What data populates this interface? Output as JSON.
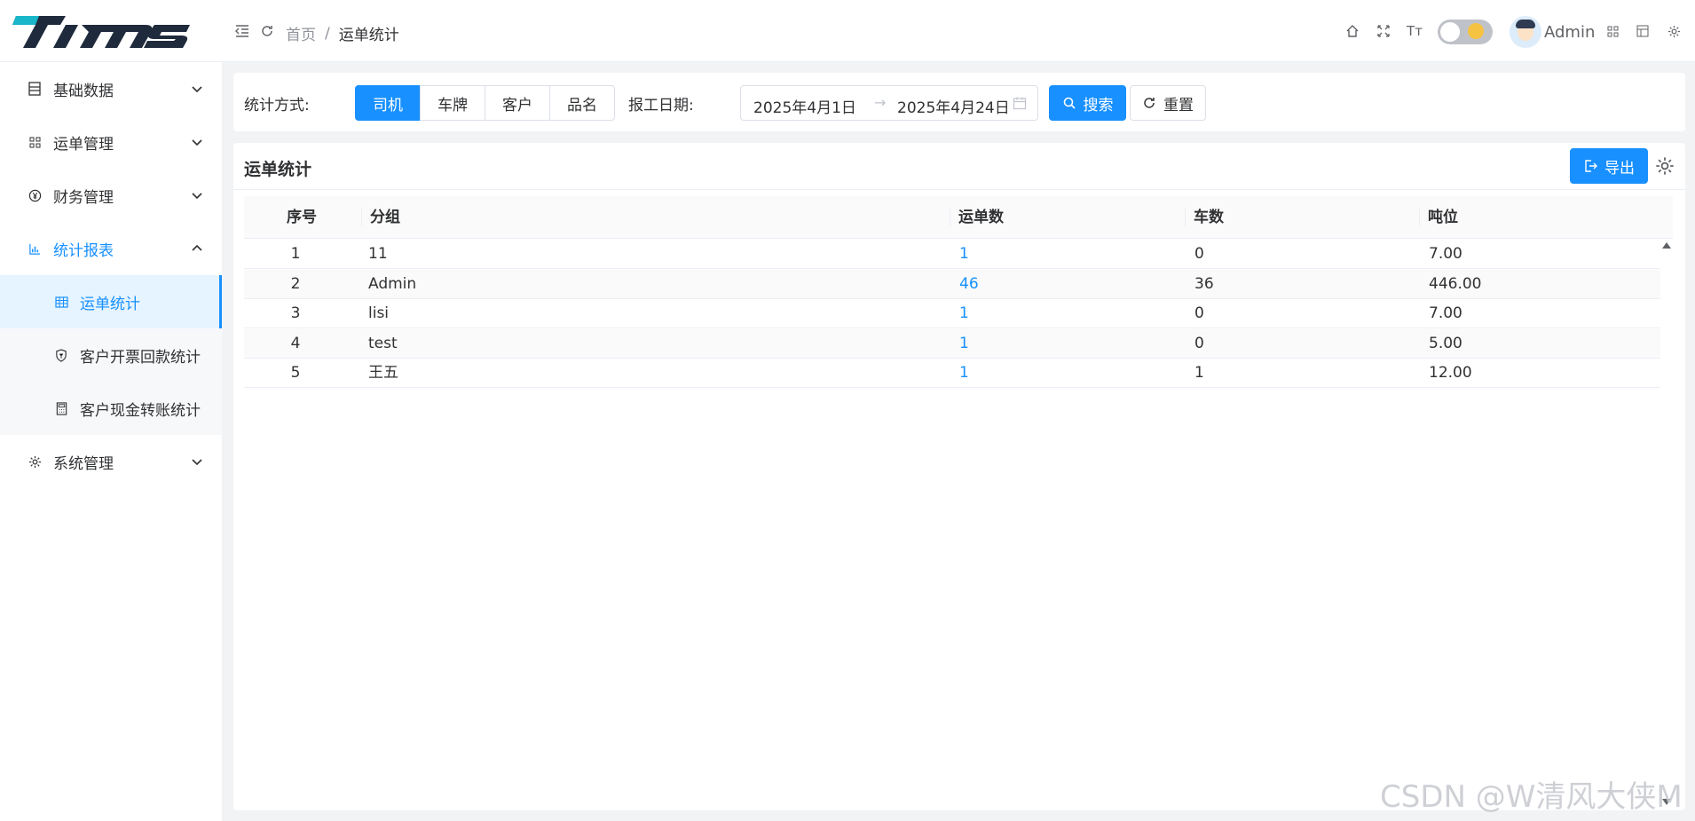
{
  "app": {
    "logo_text": "TIMS"
  },
  "header": {
    "breadcrumb": {
      "home": "首页",
      "separator": "/",
      "current": "运单统计"
    },
    "user": {
      "name": "Admin"
    }
  },
  "sidebar": {
    "items": [
      {
        "label": "基础数据",
        "icon": "list-icon",
        "expanded": false
      },
      {
        "label": "运单管理",
        "icon": "grid-icon",
        "expanded": false
      },
      {
        "label": "财务管理",
        "icon": "yen-icon",
        "expanded": false
      },
      {
        "label": "统计报表",
        "icon": "bar-chart-icon",
        "expanded": true,
        "children": [
          {
            "label": "运单统计",
            "icon": "table-icon",
            "selected": true
          },
          {
            "label": "客户开票回款统计",
            "icon": "shield-icon",
            "selected": false
          },
          {
            "label": "客户现金转账统计",
            "icon": "calculator-icon",
            "selected": false
          }
        ]
      },
      {
        "label": "系统管理",
        "icon": "gear-icon",
        "expanded": false
      }
    ]
  },
  "filter": {
    "mode_label": "统计方式:",
    "modes": [
      "司机",
      "车牌",
      "客户",
      "品名"
    ],
    "selected_mode": "司机",
    "date_label": "报工日期:",
    "date_start": "2025年4月1日",
    "date_arrow": "→",
    "date_end": "2025年4月24日",
    "search_label": "搜索",
    "reset_label": "重置"
  },
  "table": {
    "title": "运单统计",
    "export_label": "导出",
    "columns": [
      "序号",
      "分组",
      "运单数",
      "车数",
      "吨位"
    ],
    "rows": [
      {
        "index": "1",
        "group": "11",
        "orders": "1",
        "cars": "0",
        "tonnage": "7.00"
      },
      {
        "index": "2",
        "group": "Admin",
        "orders": "46",
        "cars": "36",
        "tonnage": "446.00"
      },
      {
        "index": "3",
        "group": "lisi",
        "orders": "1",
        "cars": "0",
        "tonnage": "7.00"
      },
      {
        "index": "4",
        "group": "test",
        "orders": "1",
        "cars": "0",
        "tonnage": "5.00"
      },
      {
        "index": "5",
        "group": "王五",
        "orders": "1",
        "cars": "1",
        "tonnage": "12.00"
      }
    ]
  },
  "watermark": "CSDN @W清风大侠M",
  "colors": {
    "primary": "#1890ff",
    "sidebar_active_bg": "#e6f4ff",
    "text": "#303133"
  }
}
